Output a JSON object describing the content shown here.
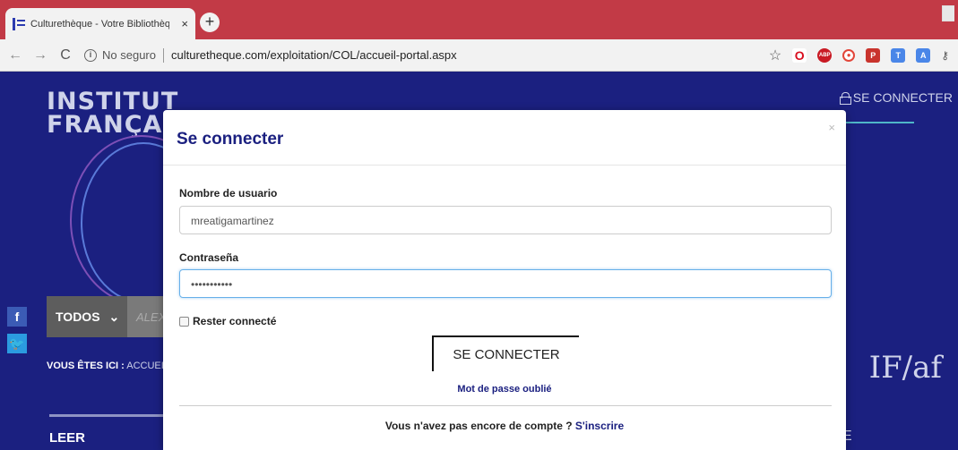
{
  "browser": {
    "tab_title": "Culturethèque - Votre Bibliothèq",
    "tab_close": "×",
    "new_tab": "+",
    "security_label": "No seguro",
    "url": "culturetheque.com/exploitation/COL/accueil-portal.aspx",
    "star": "☆",
    "extensions": [
      {
        "name": "opera-icon",
        "glyph": "O",
        "color": "#d80e1f"
      },
      {
        "name": "adblock-icon",
        "glyph": "ABP",
        "color": "#c91a24"
      },
      {
        "name": "record-icon",
        "glyph": "●",
        "color": "#e2463a"
      },
      {
        "name": "pdf-icon",
        "glyph": "⅄",
        "color": "#c9342d"
      },
      {
        "name": "translate-icon",
        "glyph": "T",
        "color": "#4a86e8"
      },
      {
        "name": "docs-icon",
        "glyph": "A",
        "color": "#4a86e8"
      }
    ]
  },
  "site": {
    "logo_line1": "INSTITUT",
    "logo_line2": "FRANÇAIS",
    "top_connect": "SE CONNECTER",
    "social_facebook": "f",
    "social_twitter": "t",
    "search_category": "TODOS",
    "search_chevron": "⌄",
    "search_placeholder": "ALEX",
    "breadcrumb_label": "VOUS ÊTES ICI :",
    "breadcrumb_value": "ACCUEIL",
    "section_title": "LEER",
    "ifaf_logo": "IF/af",
    "right_letter": "E"
  },
  "modal": {
    "title": "Se connecter",
    "close": "×",
    "username_label": "Nombre de usuario",
    "username_value": "mreatigamartinez",
    "password_label": "Contraseña",
    "password_value": "•••••••••••",
    "remember_label": "Rester connecté",
    "submit_label": "SE CONNECTER",
    "forgot_label": "Mot de passe oublié",
    "register_text": "Vous n'avez pas encore de compte ?",
    "register_link": "S'inscrire"
  }
}
